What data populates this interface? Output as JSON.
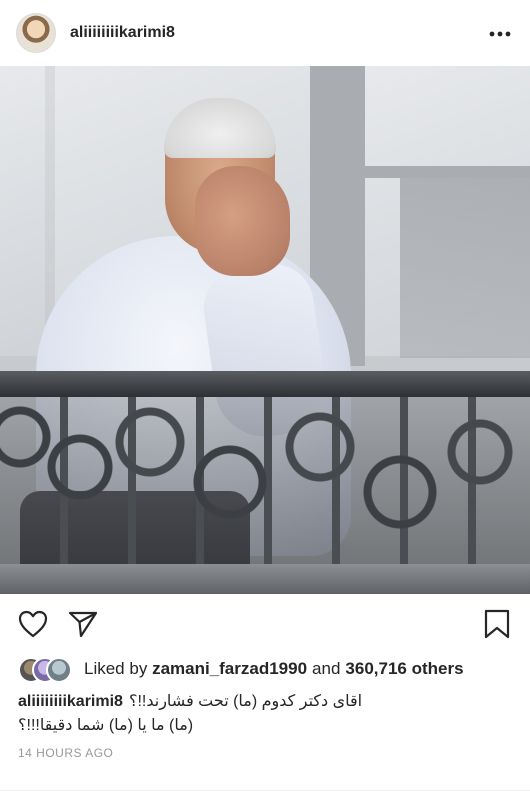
{
  "header": {
    "username": "aliiiiiiiikarimi8",
    "more_icon": "more-horizontal-icon"
  },
  "photo": {
    "subject": "post-photo"
  },
  "actions": {
    "like_icon": "heart-icon",
    "share_icon": "send-icon",
    "save_icon": "bookmark-icon"
  },
  "likes": {
    "prefix": "Liked by",
    "user": "zamani_farzad1990",
    "connector": "and",
    "others": "360,716 others"
  },
  "caption": {
    "username": "aliiiiiiiikarimi8",
    "line1": "اقای دکتر کدوم (ما) تحت فشارند!!؟",
    "line2": "(ما) ما یا (ما) شما دقیقا!!!؟"
  },
  "timestamp": "14 HOURS AGO",
  "colors": {
    "text": "#262626",
    "muted": "#999999",
    "divider": "#efefef"
  }
}
